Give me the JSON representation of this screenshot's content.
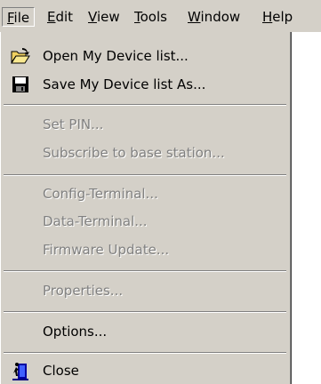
{
  "menubar": {
    "file": {
      "ul": "F",
      "rest": "ile"
    },
    "edit": {
      "ul": "E",
      "rest": "dit"
    },
    "view": {
      "ul": "V",
      "rest": "iew"
    },
    "tools": {
      "ul": "T",
      "rest": "ools"
    },
    "window": {
      "ul": "W",
      "rest": "indow"
    },
    "help": {
      "ul": "H",
      "rest": "elp"
    }
  },
  "file_menu": {
    "open": "Open My Device list...",
    "save": "Save My Device list As...",
    "set_pin": "Set PIN...",
    "subscribe": "Subscribe to base station...",
    "config_terminal": "Config-Terminal...",
    "data_terminal": "Data-Terminal...",
    "firmware_update": "Firmware Update...",
    "properties": "Properties...",
    "options": "Options...",
    "close": "Close"
  },
  "icons": {
    "open": "open-folder-icon",
    "save": "floppy-disk-icon",
    "close": "exit-door-icon"
  },
  "colors": {
    "menu_bg": "#d4d0c8",
    "disabled_text": "#808080"
  }
}
